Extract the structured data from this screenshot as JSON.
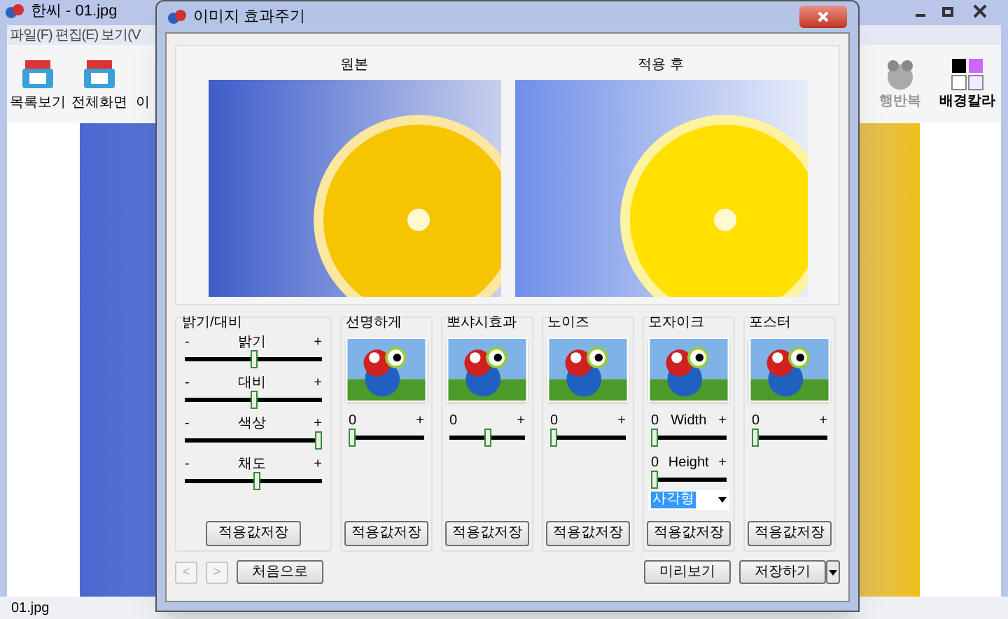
{
  "app_window": {
    "title": "한씨 - 01.jpg",
    "menu": [
      "파일(F)",
      "편집(E)",
      "보기(V"
    ],
    "toolbar_left": [
      {
        "label": "목록보기",
        "disabled": false
      },
      {
        "label": "전체화면",
        "disabled": false
      },
      {
        "label": "이",
        "disabled": false
      }
    ],
    "toolbar_right": [
      {
        "label": "행반복",
        "disabled": true
      },
      {
        "label": "배경칼라",
        "disabled": false
      }
    ],
    "status_bar": "01.jpg"
  },
  "dialog": {
    "title": "이미지 효과주기",
    "previews": [
      {
        "label": "원본"
      },
      {
        "label": "적용 후"
      }
    ],
    "adjust": {
      "title": "밝기/대비",
      "button": "적용값저장",
      "sliders": [
        {
          "label": "밝기",
          "min": "-",
          "max": "+",
          "level": 0.5
        },
        {
          "label": "대비",
          "min": "-",
          "max": "+",
          "level": 0.5
        },
        {
          "label": "색상",
          "min": "-",
          "max": "+",
          "level": 1.0
        },
        {
          "label": "채도",
          "min": "-",
          "max": "+",
          "level": 0.53
        }
      ]
    },
    "effects": [
      {
        "title": "선명하게",
        "button": "적용값저장",
        "sliders": [
          {
            "min": "0",
            "max": "+",
            "level": 0
          }
        ]
      },
      {
        "title": "뽀샤시효과",
        "button": "적용값저장",
        "sliders": [
          {
            "min": "0",
            "max": "+",
            "level": 0.5
          }
        ]
      },
      {
        "title": "노이즈",
        "button": "적용값저장",
        "sliders": [
          {
            "min": "0",
            "max": "+",
            "level": 0
          }
        ]
      },
      {
        "title": "모자이크",
        "button": "적용값저장",
        "sliders": [
          {
            "label": "Width",
            "min": "0",
            "max": "+",
            "level": 0
          },
          {
            "label": "Height",
            "min": "0",
            "max": "+",
            "level": 0
          }
        ],
        "dropdown": {
          "value": "사각형"
        }
      },
      {
        "title": "포스터",
        "button": "적용값저장",
        "sliders": [
          {
            "min": "0",
            "max": "+",
            "level": 0
          }
        ]
      }
    ],
    "nav": [
      {
        "label": "<",
        "disabled": true
      },
      {
        "label": ">",
        "disabled": true
      }
    ],
    "first_button": "처음으로",
    "preview_button": "미리보기",
    "save_button": "저장하기"
  }
}
